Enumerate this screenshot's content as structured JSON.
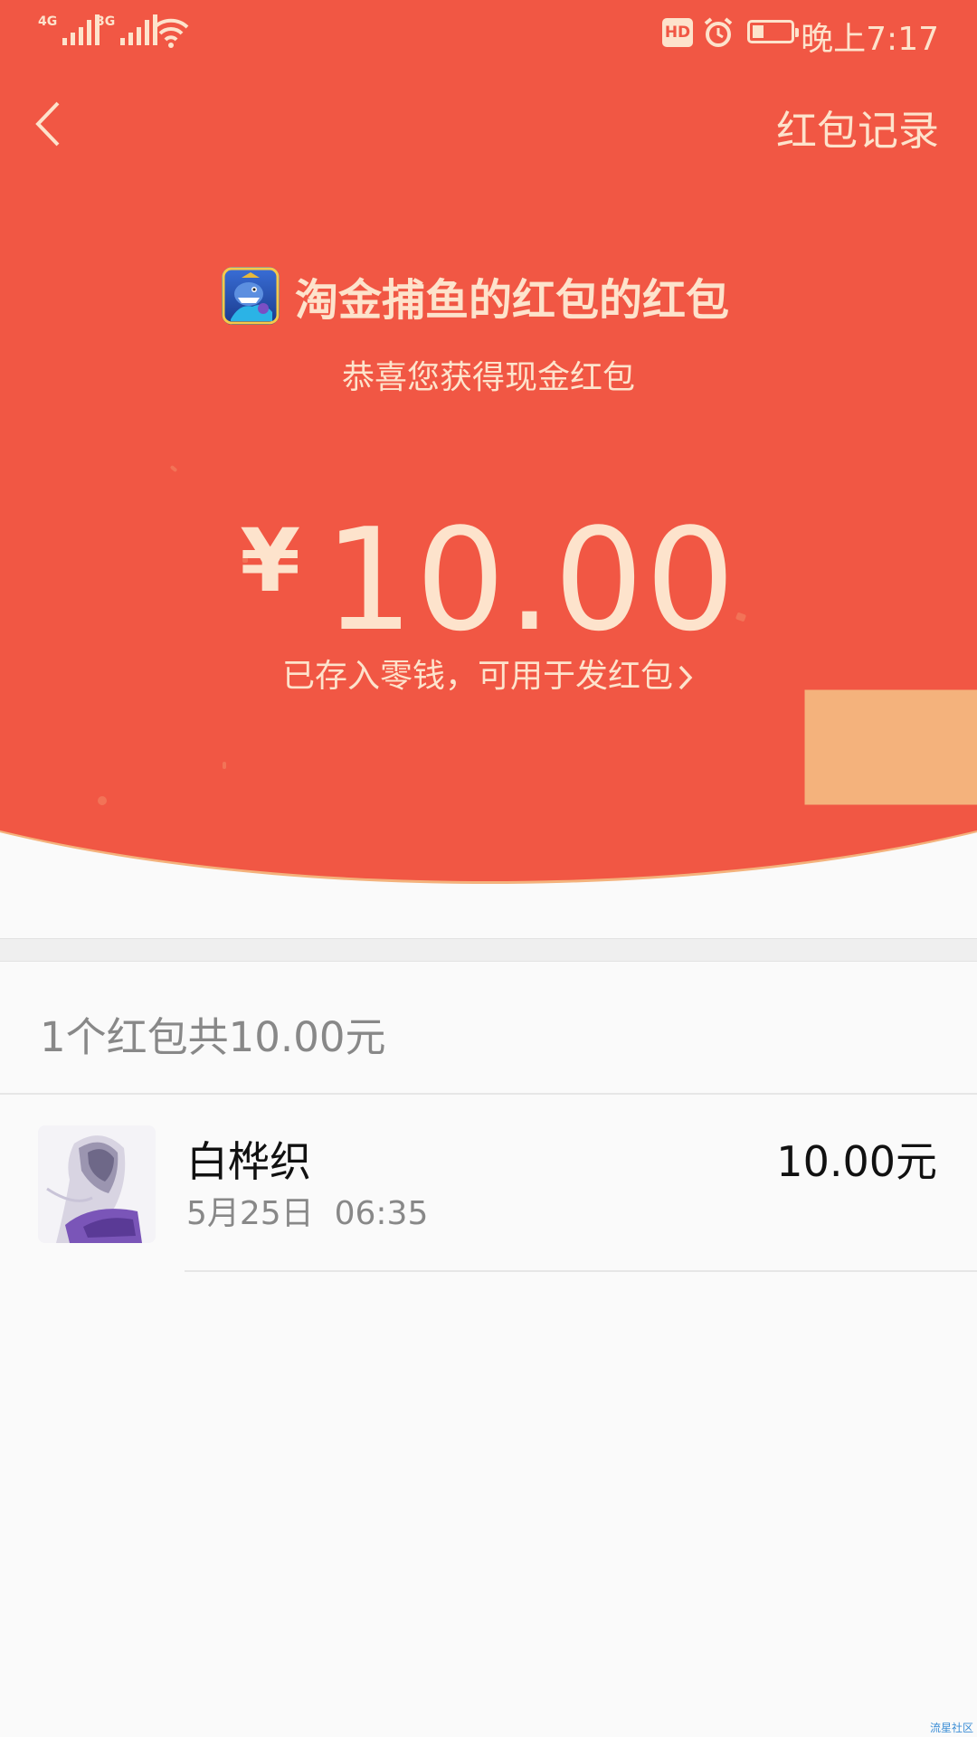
{
  "status_bar": {
    "network_1": "4G",
    "network_2": "3G",
    "hd_badge": "HD",
    "battery_level": 0.3,
    "time": "晚上7:17"
  },
  "header": {
    "records_link": "红包记录"
  },
  "packet": {
    "title": "淘金捕鱼的红包的红包",
    "subtitle": "恭喜您获得现金红包",
    "currency_symbol": "¥",
    "amount": "10.00",
    "wallet_note": "已存入零钱，可用于发红包"
  },
  "summary": {
    "text": "1个红包共10.00元"
  },
  "records": [
    {
      "name": "白桦织",
      "time": "5月25日  06:35",
      "amount": "10.00元"
    }
  ],
  "watermark": "流星社区",
  "colors": {
    "primary_red": "#f15744",
    "gold_text": "#fde3cc",
    "page_bg": "#fafafa"
  },
  "icons": [
    "back-chevron-icon",
    "fish-game-app-icon",
    "chevron-right-icon",
    "alarm-icon",
    "wifi-icon"
  ]
}
